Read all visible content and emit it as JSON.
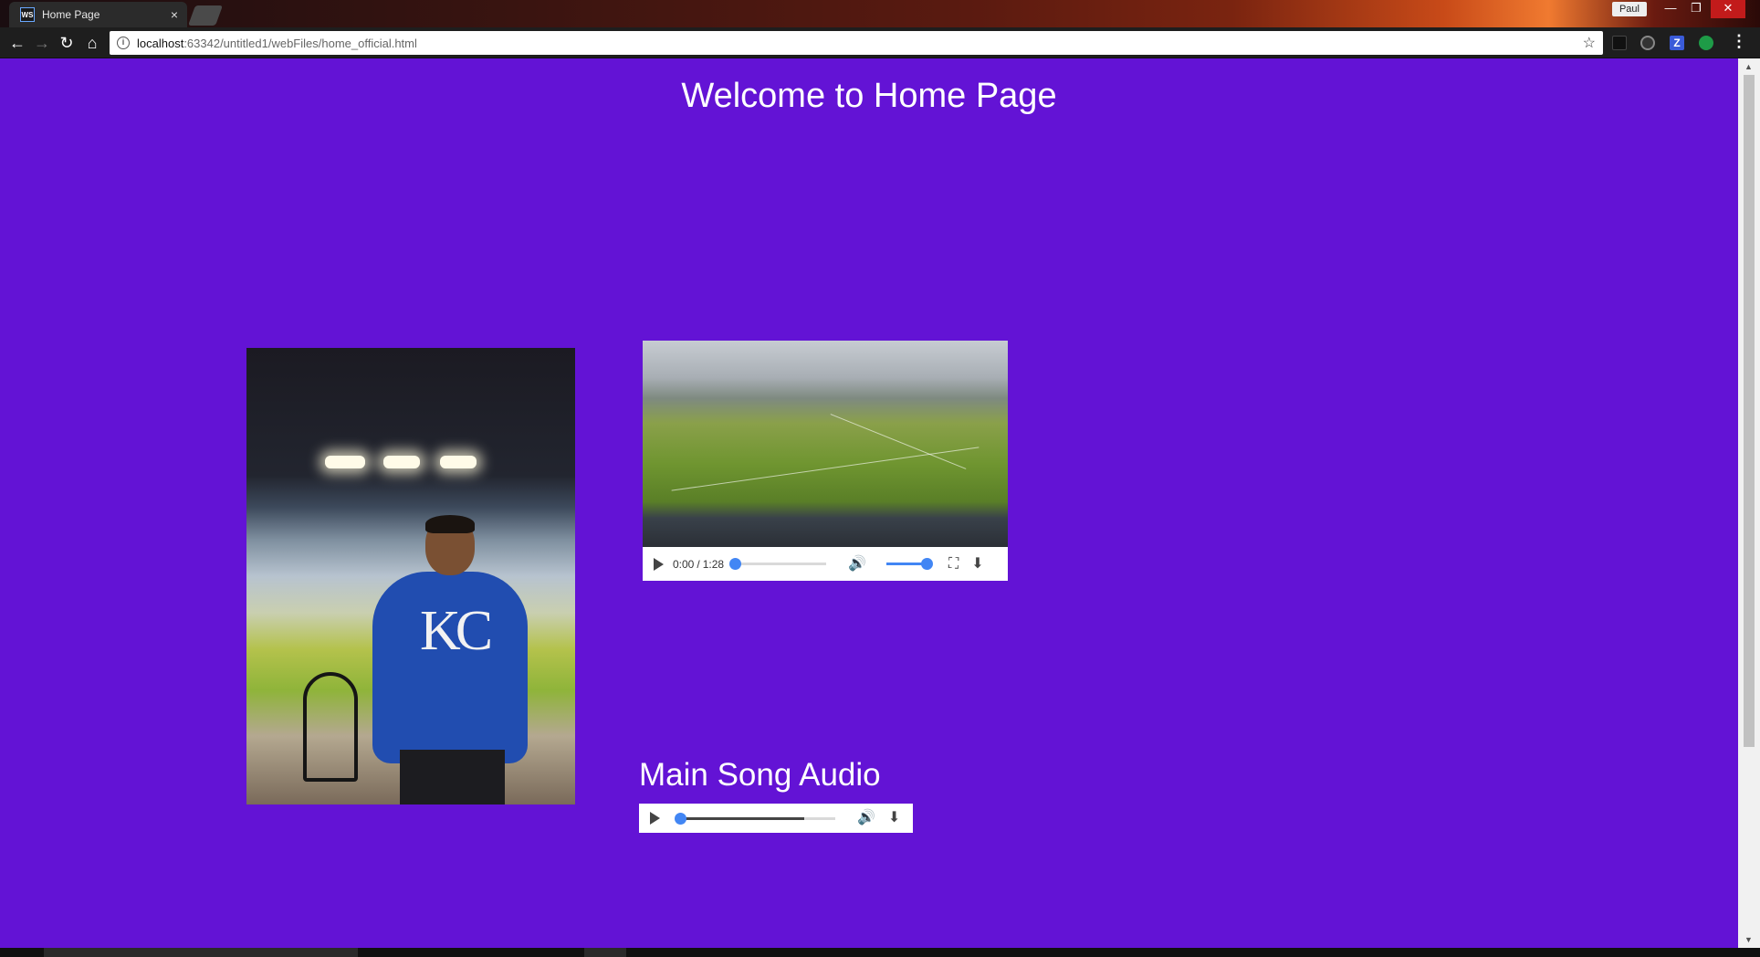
{
  "browser": {
    "tab": {
      "title": "Home Page",
      "favicon_text": "WS",
      "close_glyph": "×"
    },
    "user_badge": "Paul",
    "window_controls": {
      "minimize": "—",
      "maximize": "❐",
      "close": "✕"
    },
    "nav": {
      "back": "←",
      "forward": "→",
      "reload": "↻",
      "home": "⌂"
    },
    "address": {
      "host": "localhost",
      "path": ":63342/untitled1/webFiles/home_official.html"
    },
    "extensions": [
      {
        "name": "black-square-extension-icon"
      },
      {
        "name": "shield-extension-icon"
      },
      {
        "name": "zotero-extension-icon",
        "label": "Z"
      },
      {
        "name": "green-leaf-extension-icon"
      }
    ],
    "menu": "⋮"
  },
  "page": {
    "background_color": "#6313d5",
    "title": "Welcome to Home Page",
    "photo": {
      "description": "KC"
    },
    "video": {
      "current_time": "0:00",
      "separator": "/",
      "duration": "1:28",
      "progress": 0.0,
      "volume": 1.0
    },
    "audio": {
      "heading": "Main Song Audio",
      "progress": 0.0,
      "buffered": 0.8
    }
  },
  "icons": {
    "mute": "🔊",
    "fullscreen": "⛶",
    "download": "⬇"
  }
}
